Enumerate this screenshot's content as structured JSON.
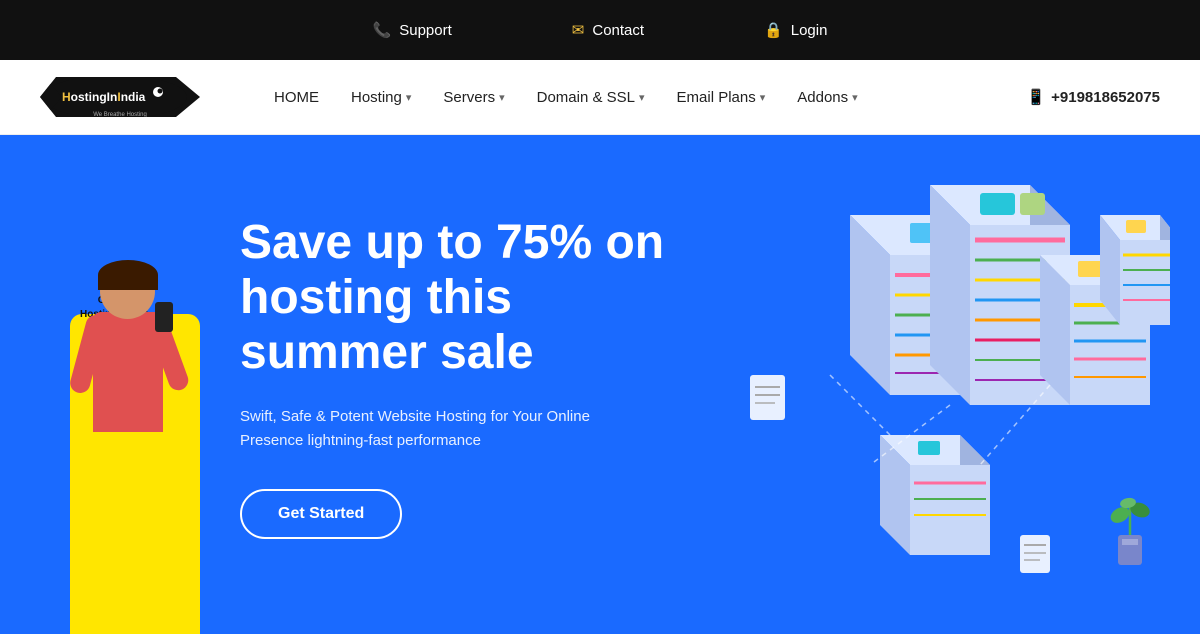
{
  "topbar": {
    "support_label": "Support",
    "contact_label": "Contact",
    "login_label": "Login"
  },
  "navbar": {
    "logo_text": "HostingInIndia",
    "logo_tagline": "We Breathe Hosting",
    "nav_items": [
      {
        "label": "HOME",
        "has_dropdown": false
      },
      {
        "label": "Hosting",
        "has_dropdown": true
      },
      {
        "label": "Servers",
        "has_dropdown": true
      },
      {
        "label": "Domain & SSL",
        "has_dropdown": true
      },
      {
        "label": "Email Plans",
        "has_dropdown": true
      },
      {
        "label": "Addons",
        "has_dropdown": true
      }
    ],
    "phone": "+919818652075"
  },
  "hero": {
    "title": "Save up to 75% on hosting this summer sale",
    "subtitle": "Swift, Safe & Potent Website Hosting for Your Online Presence lightning-fast performance",
    "cta_button": "Get Started",
    "card_text": "Only at\nHostingInIndia\nPersonal\nconsultant"
  }
}
